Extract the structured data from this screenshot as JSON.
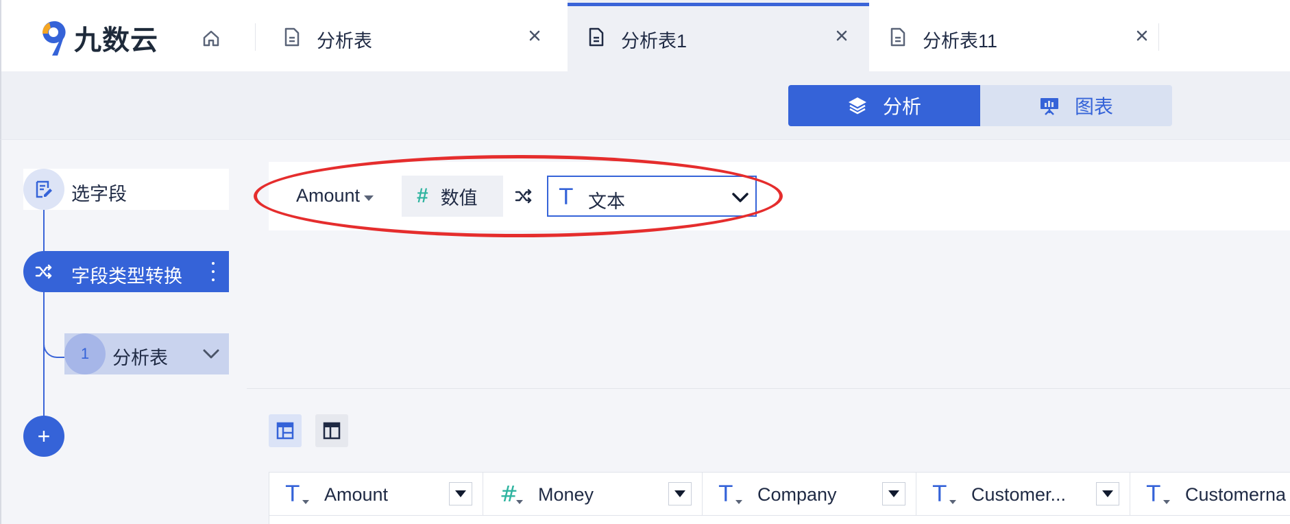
{
  "app": {
    "logo_text": "九数云"
  },
  "tabs": [
    {
      "label": "分析表",
      "active": false
    },
    {
      "label": "分析表1",
      "active": true
    },
    {
      "label": "分析表11",
      "active": false
    }
  ],
  "toolbar": {
    "analyze_label": "分析",
    "chart_label": "图表"
  },
  "steps": {
    "select_fields": "选字段",
    "type_convert": "字段类型转换",
    "sub_number": "1",
    "sub_label": "分析表",
    "add_symbol": "+"
  },
  "convert": {
    "field": "Amount",
    "source_type": "数值",
    "source_symbol": "#",
    "target_symbol": "T",
    "target_type": "文本"
  },
  "table": {
    "columns": [
      {
        "type_symbol": "T",
        "type": "text",
        "name": "Amount"
      },
      {
        "type_symbol": "#",
        "type": "number",
        "name": "Money"
      },
      {
        "type_symbol": "T",
        "type": "text",
        "name": "Company"
      },
      {
        "type_symbol": "T",
        "type": "text",
        "name": "Customer..."
      },
      {
        "type_symbol": "T",
        "type": "text",
        "name": "Customerna"
      }
    ]
  },
  "colors": {
    "accent": "#3563d8",
    "accent_light": "#d9e1f2",
    "number_type": "#2fb4a0",
    "annotation": "#e52d2d"
  },
  "icons": {
    "home": "home-icon",
    "document": "document-icon",
    "close": "close-icon",
    "layers": "layers-icon",
    "presentation": "presentation-chart-icon",
    "shuffle": "shuffle-icon",
    "more": "more-vertical-icon",
    "chevron": "chevron-down-icon"
  }
}
